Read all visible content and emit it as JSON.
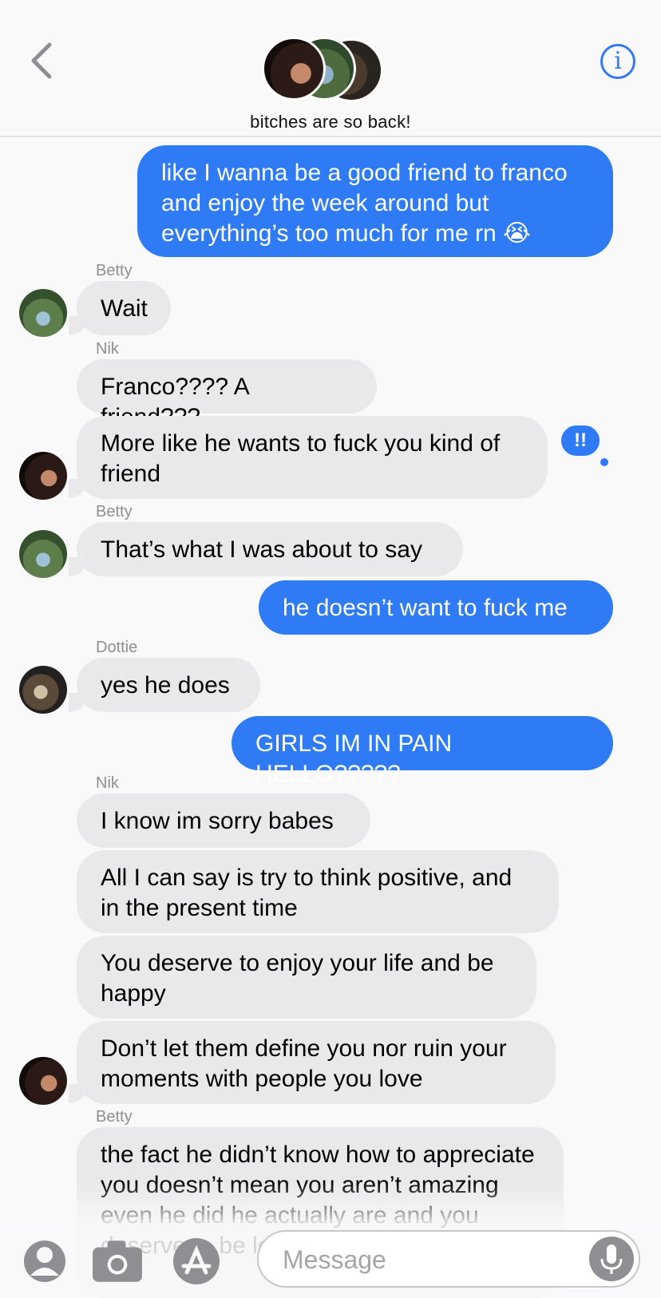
{
  "header": {
    "group_name": "bitches are so back!",
    "back_icon": "chevron-left-icon",
    "info_label": "i",
    "accent_color": "#3478f6"
  },
  "messages": [
    {
      "from": "me",
      "text": "like I wanna be a good friend to franco and enjoy the week around but everything’s too much for me rn 😭"
    },
    {
      "from": "Betty",
      "sender_label": "Betty",
      "text": "Wait"
    },
    {
      "from": "Nik",
      "sender_label": "Nik",
      "text": "Franco???? A friend???"
    },
    {
      "from": "Nik",
      "text": "More like he wants to fuck you kind of friend",
      "reaction": "!!"
    },
    {
      "from": "Betty",
      "sender_label": "Betty",
      "text": "That’s what I was about to say"
    },
    {
      "from": "me",
      "text": "he doesn’t want to fuck me"
    },
    {
      "from": "Dottie",
      "sender_label": "Dottie",
      "text": "yes he does"
    },
    {
      "from": "me",
      "text": "GIRLS IM IN PAIN HELLO?????"
    },
    {
      "from": "Nik",
      "sender_label": "Nik",
      "text": "I know im sorry babes"
    },
    {
      "from": "Nik",
      "text": "All I can say is try to think positive, and in the present time"
    },
    {
      "from": "Nik",
      "text": "You deserve to enjoy your life and be happy"
    },
    {
      "from": "Nik",
      "text": "Don’t let them define you nor ruin your moments with people you love"
    },
    {
      "from": "Betty",
      "sender_label": "Betty",
      "text": "the fact he didn’t know how to appreciate you doesn’t mean you aren’t amazing even he did he actually are and you deserve to be loved and be happy"
    }
  ],
  "colors": {
    "outgoing_bubble": "#2f7bf5",
    "incoming_bubble": "#e9e9eb"
  },
  "toolbar": {
    "memoji_icon": "memoji-icon",
    "camera_icon": "camera-icon",
    "appstore_icon": "app-store-icon",
    "message_placeholder": "Message",
    "mic_icon": "microphone-icon"
  }
}
